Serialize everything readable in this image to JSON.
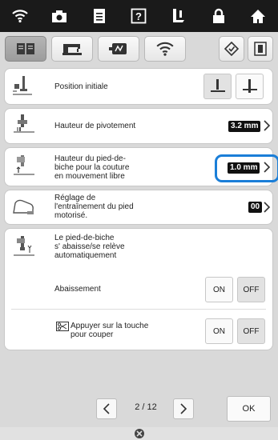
{
  "top_bar": {
    "icons": [
      "wifi-icon",
      "camera-icon",
      "document-icon",
      "help-icon",
      "presser-foot-icon",
      "lock-icon",
      "home-icon"
    ]
  },
  "tabs": {
    "icons": [
      "book-icon",
      "sewing-machine-icon",
      "embroidery-frame-icon",
      "wifi-icon",
      "diamond-settings-icon",
      "frame-icon"
    ]
  },
  "settings": {
    "position_initiale": {
      "label": "Position initiale"
    },
    "hauteur_pivotement": {
      "label": "Hauteur de pivotement",
      "value": "3.2 mm"
    },
    "hauteur_pied": {
      "label": "Hauteur du pied-de-\nbiche pour la couture\nen mouvement libre",
      "value": "1.0 mm"
    },
    "reglage_entrainement": {
      "label": "Réglage de\nl'entraînement du pied\nmotorisé.",
      "value": "00"
    },
    "pied_auto": {
      "label": "Le pied-de-biche\ns' abaisse/se relève\nautomatiquement",
      "abaissement_label": "Abaissement",
      "couper_label": "Appuyer sur la touche\npour couper",
      "on_label": "ON",
      "off_label": "OFF"
    }
  },
  "pagination": {
    "current": "2",
    "separator": "/",
    "total": "12"
  },
  "ok_label": "OK",
  "bottom_icon": "needle-icon",
  "colors": {
    "highlight": "#1a7ed8",
    "topbar": "#1a1a1a",
    "background": "#d9d9d9"
  }
}
